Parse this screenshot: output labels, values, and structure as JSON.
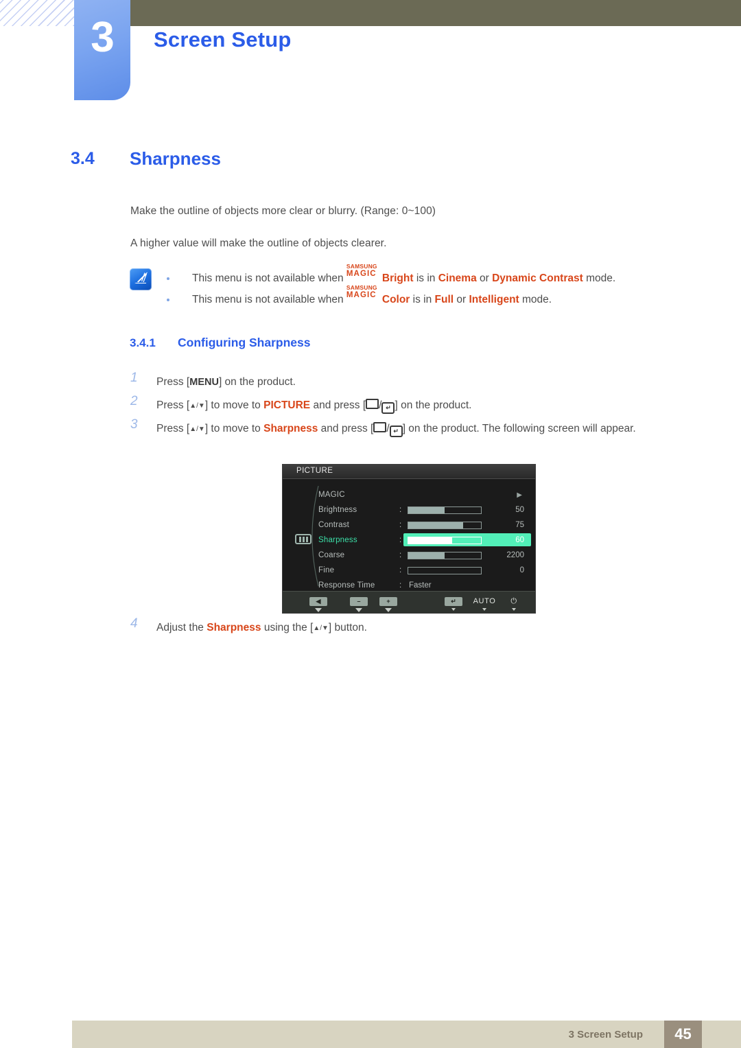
{
  "header": {
    "chapter_number": "3",
    "chapter_title": "Screen Setup"
  },
  "section": {
    "number": "3.4",
    "title": "Sharpness",
    "paragraph_1": "Make the outline of objects more clear or blurry. (Range: 0~100)",
    "paragraph_2": "A higher value will make the outline of objects clearer."
  },
  "note": {
    "icon": "note-pencil-icon",
    "items": [
      {
        "prefix": "This menu is not available when ",
        "magic_top": "SAMSUNG",
        "magic_bottom": "MAGIC",
        "feature": "Bright",
        "mid": " is in ",
        "value_1": "Cinema",
        "conj": " or ",
        "value_2": "Dynamic Contrast",
        "suffix": " mode."
      },
      {
        "prefix": "This menu is not available when ",
        "magic_top": "SAMSUNG",
        "magic_bottom": "MAGIC",
        "feature": "Color",
        "mid": " is in ",
        "value_1": "Full",
        "conj": " or ",
        "value_2": "Intelligent",
        "suffix": " mode."
      }
    ]
  },
  "subsection": {
    "number": "3.4.1",
    "title": "Configuring Sharpness"
  },
  "steps": [
    {
      "number": "1",
      "part_a": "Press [",
      "key": "MENU",
      "part_b": "] on the product."
    },
    {
      "number": "2",
      "part_a": "Press [",
      "arrows": "▲/▼",
      "part_b": "] to move to ",
      "target": "PICTURE",
      "part_c": " and press [",
      "part_d": "/",
      "part_e": "] on the product."
    },
    {
      "number": "3",
      "part_a": "Press [",
      "arrows": "▲/▼",
      "part_b": "] to move to ",
      "target": "Sharpness",
      "part_c": " and press [",
      "part_d": "/",
      "part_e": "] on the product. The following screen will appear."
    },
    {
      "number": "4",
      "part_a": "Adjust the ",
      "target": "Sharpness",
      "part_b": " using the [",
      "arrows": "▲/▼",
      "part_c": "] button."
    }
  ],
  "osd": {
    "title": "PICTURE",
    "category_icon": "picture-bars-icon",
    "rows": [
      {
        "label": "MAGIC",
        "type": "submenu",
        "arrow": "▶",
        "value": "",
        "fill": 0,
        "selected": false
      },
      {
        "label": "Brightness",
        "type": "slider",
        "value": "50",
        "fill": 50,
        "selected": false
      },
      {
        "label": "Contrast",
        "type": "slider",
        "value": "75",
        "fill": 75,
        "selected": false
      },
      {
        "label": "Sharpness",
        "type": "slider",
        "value": "60",
        "fill": 60,
        "selected": true
      },
      {
        "label": "Coarse",
        "type": "slider",
        "value": "2200",
        "fill": 50,
        "selected": false
      },
      {
        "label": "Fine",
        "type": "slider",
        "value": "0",
        "fill": 0,
        "selected": false
      },
      {
        "label": "Response Time",
        "type": "text",
        "value": "Faster",
        "selected": false
      }
    ],
    "footer_buttons": [
      {
        "name": "back-button",
        "glyph": "◀"
      },
      {
        "name": "minus-button",
        "glyph": "–"
      },
      {
        "name": "plus-button",
        "glyph": "+"
      },
      {
        "name": "enter-button",
        "glyph": "↵"
      },
      {
        "name": "auto-button",
        "glyph": "AUTO"
      },
      {
        "name": "power-button",
        "glyph": "⏻"
      }
    ]
  },
  "footer": {
    "text": "3 Screen Setup",
    "page": "45"
  },
  "colors": {
    "accent_blue": "#2b5ce8",
    "accent_red": "#d8461a",
    "header_olive": "#6b6a55",
    "footer_beige": "#d8d4c1",
    "page_badge": "#9a8f7e",
    "osd_highlight_green": "#52efb8"
  }
}
